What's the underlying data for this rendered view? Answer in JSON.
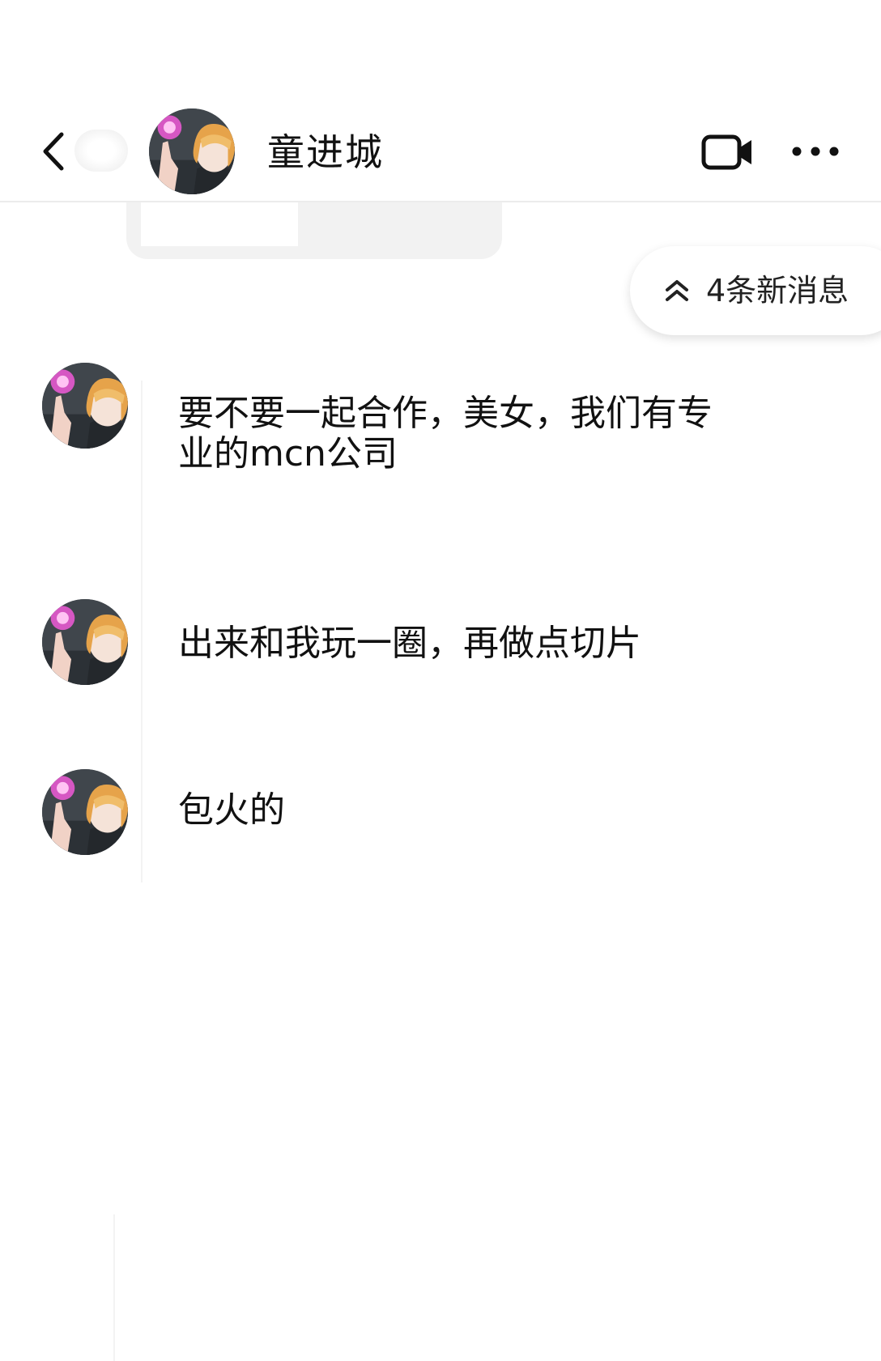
{
  "header": {
    "contact_name": "童进城",
    "icons": {
      "back": "chevron-left-icon",
      "video": "video-call-icon",
      "more": "more-horizontal-icon"
    }
  },
  "new_messages_pill": {
    "label": "4条新消息",
    "icon": "double-chevron-up-icon"
  },
  "messages": [
    {
      "sender": "童进城",
      "text": "要不要一起合作，美女，我们有专业的mcn公司"
    },
    {
      "sender": "童进城",
      "text": "出来和我玩一圈，再做点切片"
    },
    {
      "sender": "童进城",
      "text": "包火的"
    }
  ],
  "colors": {
    "background": "#ffffff",
    "text": "#111111",
    "divider": "#ececec",
    "bubble_gray": "#f2f2f2"
  }
}
